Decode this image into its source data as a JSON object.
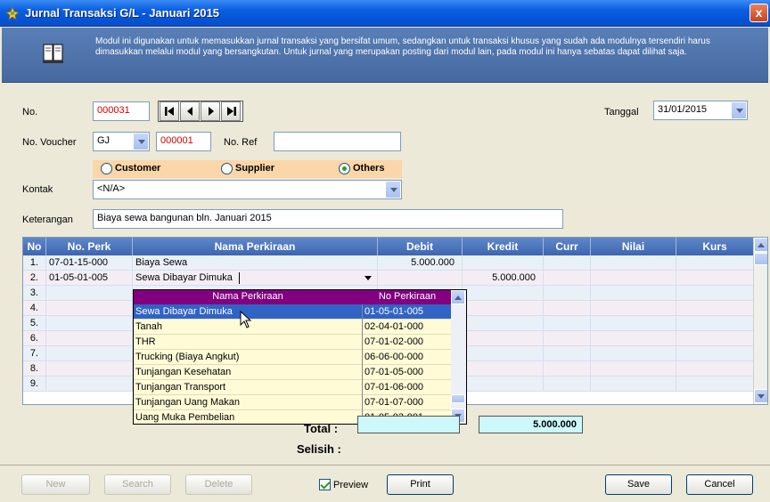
{
  "window": {
    "title": "Jurnal Transaksi G/L - Januari 2015",
    "close_label": "x"
  },
  "banner": {
    "text": "Modul ini digunakan untuk memasukkan jurnal transaksi yang bersifat umum, sedangkan untuk transaksi khusus yang sudah ada modulnya tersendiri harus dimasukkan melalui modul yang bersangkutan. Untuk jurnal yang merupakan posting dari modul lain, pada modul ini hanya sebatas dapat dilihat saja."
  },
  "form": {
    "no_label": "No.",
    "no_value": "000031",
    "tanggal_label": "Tanggal",
    "tanggal_value": "31/01/2015",
    "voucher_label": "No. Voucher",
    "voucher_type": "GJ",
    "voucher_number": "000001",
    "ref_label": "No. Ref",
    "ref_value": "",
    "radio_customer": "Customer",
    "radio_supplier": "Supplier",
    "radio_others": "Others",
    "kontak_label": "Kontak",
    "kontak_value": "<N/A>",
    "keterangan_label": "Keterangan",
    "keterangan_value": "Biaya sewa bangunan bln. Januari 2015"
  },
  "grid": {
    "headers": [
      "No",
      "No. Perk",
      "Nama Perkiraan",
      "Debit",
      "Kredit",
      "Curr",
      "Nilai",
      "Kurs"
    ],
    "rows": [
      {
        "no": "1.",
        "perk": "07-01-15-000",
        "nama": "Biaya Sewa",
        "debit": "5.000.000",
        "kredit": ""
      },
      {
        "no": "2.",
        "perk": "01-05-01-005",
        "nama": "Sewa Dibayar Dimuka",
        "debit": "",
        "kredit": "5.000.000"
      },
      {
        "no": "3.",
        "perk": "",
        "nama": "",
        "debit": "",
        "kredit": ""
      },
      {
        "no": "4.",
        "perk": "",
        "nama": "",
        "debit": "",
        "kredit": ""
      },
      {
        "no": "5.",
        "perk": "",
        "nama": "",
        "debit": "",
        "kredit": ""
      },
      {
        "no": "6.",
        "perk": "",
        "nama": "",
        "debit": "",
        "kredit": ""
      },
      {
        "no": "7.",
        "perk": "",
        "nama": "",
        "debit": "",
        "kredit": ""
      },
      {
        "no": "8.",
        "perk": "",
        "nama": "",
        "debit": "",
        "kredit": ""
      },
      {
        "no": "9.",
        "perk": "",
        "nama": "",
        "debit": "",
        "kredit": ""
      }
    ]
  },
  "popup": {
    "col_nama": "Nama Perkiraan",
    "col_no": "No Perkiraan",
    "items": [
      {
        "nama": "Sewa Dibayar Dimuka",
        "no": "01-05-01-005"
      },
      {
        "nama": "Tanah",
        "no": "02-04-01-000"
      },
      {
        "nama": "THR",
        "no": "07-01-02-000"
      },
      {
        "nama": "Trucking (Biaya Angkut)",
        "no": "06-06-00-000"
      },
      {
        "nama": "Tunjangan Kesehatan",
        "no": "07-01-05-000"
      },
      {
        "nama": "Tunjangan Transport",
        "no": "07-01-06-000"
      },
      {
        "nama": "Tunjangan Uang Makan",
        "no": "07-01-07-000"
      },
      {
        "nama": "Uang Muka Pembelian",
        "no": "01-05-03-001"
      }
    ]
  },
  "totals": {
    "total_label": "Total :",
    "total_kredit": "5.000.000",
    "selisih_label": "Selisih :"
  },
  "buttons": {
    "new": "New",
    "search": "Search",
    "delete": "Delete",
    "preview": "Preview",
    "print": "Print",
    "save": "Save",
    "cancel": "Cancel"
  }
}
